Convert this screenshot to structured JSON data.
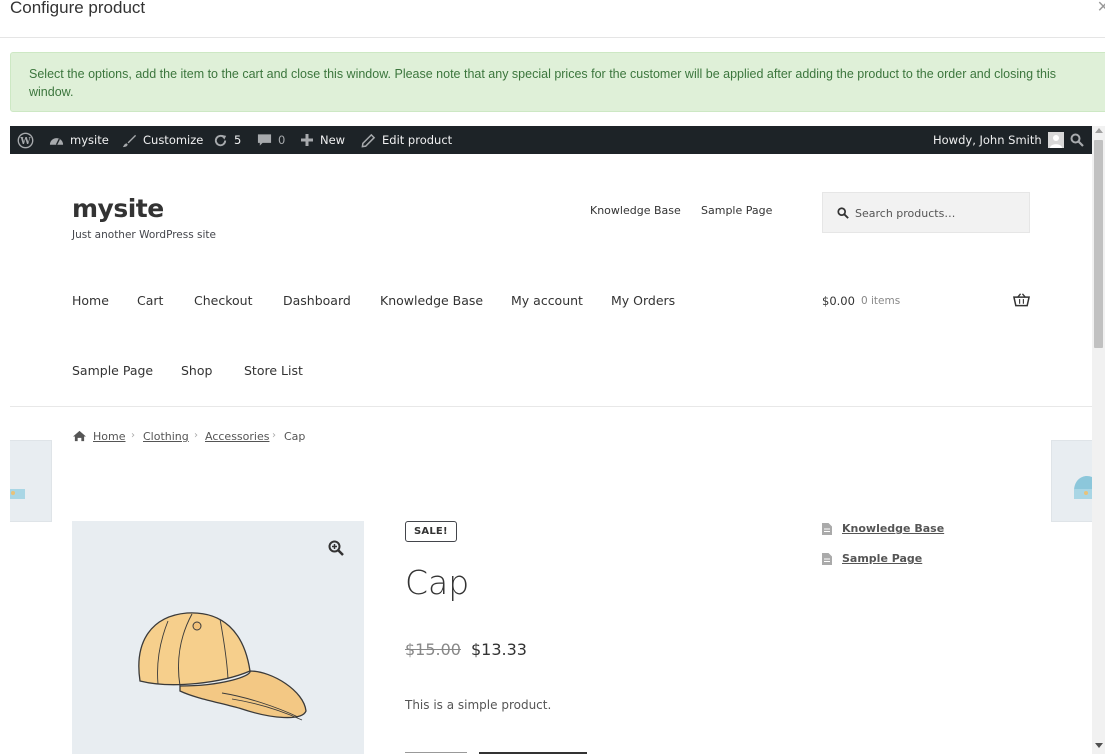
{
  "modal": {
    "title": "Configure product",
    "close": "×",
    "notice": "Select the options, add the item to the cart and close this window. Please note that any special prices for the customer will be applied after adding the product to the order and closing this window."
  },
  "admin_bar": {
    "site": "mysite",
    "customize": "Customize",
    "updates": "5",
    "comments": "0",
    "new": "New",
    "edit": "Edit product",
    "howdy": "Howdy, John Smith"
  },
  "site": {
    "title": "mysite",
    "description": "Just another WordPress site",
    "top_links": [
      "Knowledge Base",
      "Sample Page"
    ],
    "search_placeholder": "Search products…"
  },
  "nav": {
    "items": [
      "Home",
      "Cart",
      "Checkout",
      "Dashboard",
      "Knowledge Base",
      "My account",
      "My Orders",
      "Sample Page",
      "Shop",
      "Store List"
    ]
  },
  "cart": {
    "total": "$0.00",
    "count": "0 items"
  },
  "breadcrumb": {
    "items": [
      "Home",
      "Clothing",
      "Accessories",
      "Cap"
    ]
  },
  "product": {
    "badge": "SALE!",
    "title": "Cap",
    "regular_price": "$15.00",
    "sale_price": "$13.33",
    "short_description": "This is a simple product."
  },
  "sidebar_widget": {
    "links": [
      "Knowledge Base",
      "Sample Page"
    ]
  },
  "colors": {
    "admin_bar": "#1d2327",
    "notice_bg": "#dff0d8",
    "notice_text": "#3c763d"
  }
}
